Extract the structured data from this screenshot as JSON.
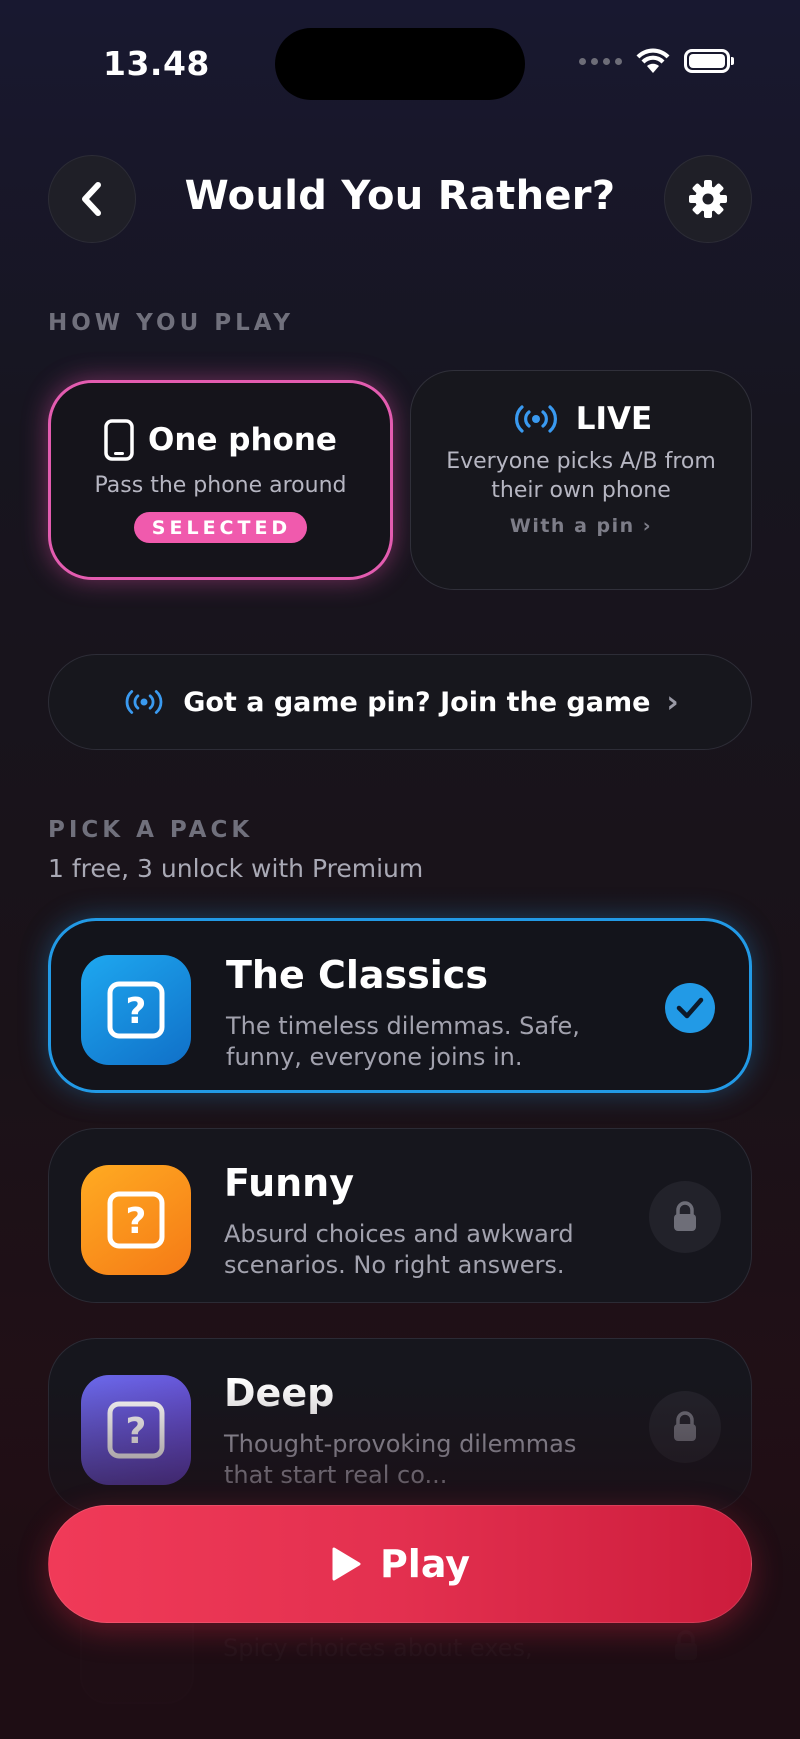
{
  "status_bar": {
    "time": "13.48"
  },
  "header": {
    "title": "Would You Rather?"
  },
  "how_you_play": {
    "label": "HOW YOU PLAY",
    "one_phone": {
      "title": "One phone",
      "subtitle": "Pass the phone around",
      "badge": "SELECTED"
    },
    "live": {
      "title": "LIVE",
      "subtitle": "Everyone picks A/B from their own phone",
      "link": "With a pin"
    }
  },
  "join": {
    "label": "Got a game pin? Join the game"
  },
  "packs": {
    "label": "PICK A PACK",
    "subtitle": "1 free, 3 unlock with Premium",
    "items": [
      {
        "title": "The Classics",
        "description": "The timeless dilemmas. Safe, funny, everyone joins in.",
        "color": "#1d8fe0"
      },
      {
        "title": "Funny",
        "description": "Absurd choices and awkward scenarios. No right answers.",
        "color": "#f58c1f"
      },
      {
        "title": "Deep",
        "description": "Thought-provoking dilemmas that start real co...",
        "color": "#6a58d6"
      },
      {
        "title": "",
        "description": "Spicy choices about exes,"
      }
    ]
  },
  "play": {
    "label": "Play"
  },
  "colors": {
    "accent_pink": "#e35cb0",
    "accent_blue": "#229ae6",
    "play_red": "#e3304f"
  }
}
